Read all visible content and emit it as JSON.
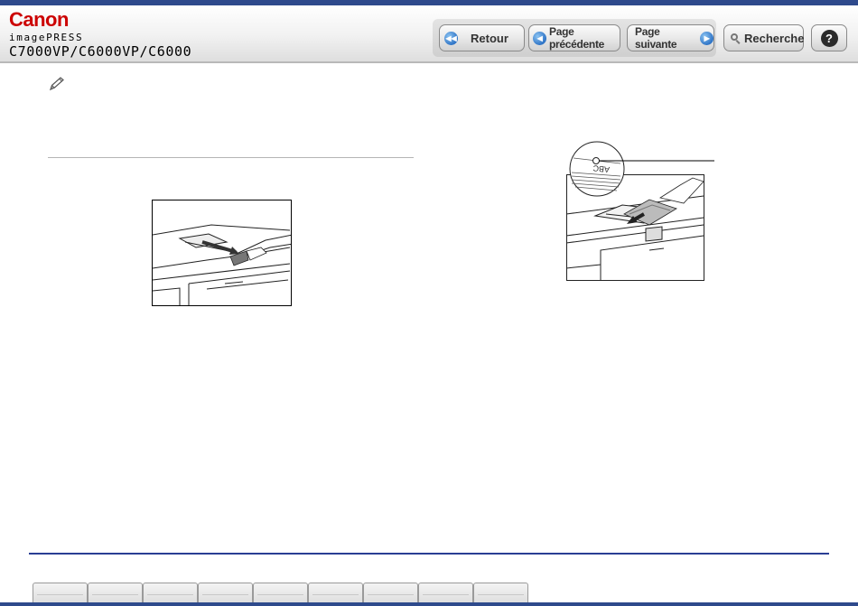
{
  "header": {
    "brand": "Canon",
    "product": "imagePRESS",
    "model": "C7000VP/C6000VP/C6000"
  },
  "nav": {
    "back_label": "Retour",
    "prev_label": "Page précédente",
    "next_label": "Page suivante",
    "search_label": "Recherche",
    "help_label": "?"
  },
  "icons": {
    "note": "pencil-icon",
    "back": "double-left-arrow-icon",
    "prev": "left-arrow-icon",
    "next": "right-arrow-icon",
    "search": "magnifier-icon",
    "help": "question-mark-icon"
  },
  "figure2": {
    "label": "ABC"
  },
  "footer": {
    "tabs": [
      "",
      "",
      "",
      "",
      "",
      "",
      "",
      "",
      ""
    ]
  },
  "colors": {
    "accent_blue": "#2e4a8c",
    "brand_red": "#cc0000",
    "button_icon_blue": "#2f74c6"
  }
}
